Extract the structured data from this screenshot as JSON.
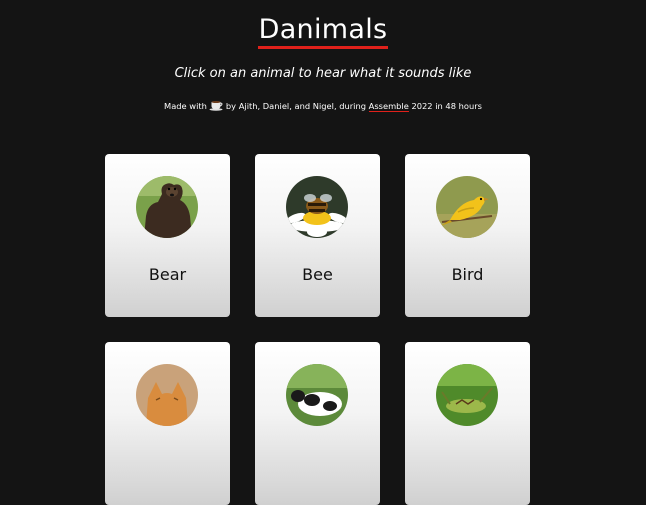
{
  "header": {
    "title": "Danimals",
    "subtitle": "Click on an animal to hear what it sounds like"
  },
  "credits": {
    "prefix": "Made with",
    "icon": "coffee-mug-icon",
    "middle": "by Ajith, Daniel, and Nigel, during",
    "link": "Assemble",
    "suffix": "2022 in 48 hours"
  },
  "colors": {
    "background": "#141414",
    "accent_underline": "#e0211b",
    "card_top": "#ffffff",
    "card_bottom": "#d0d0d0"
  },
  "animals": [
    {
      "name": "Bear",
      "icon": "bear-photo"
    },
    {
      "name": "Bee",
      "icon": "bee-photo"
    },
    {
      "name": "Bird",
      "icon": "bird-photo"
    },
    {
      "name": "",
      "icon": "cat-photo"
    },
    {
      "name": "",
      "icon": "cow-photo"
    },
    {
      "name": "",
      "icon": "grasshopper-photo"
    }
  ]
}
